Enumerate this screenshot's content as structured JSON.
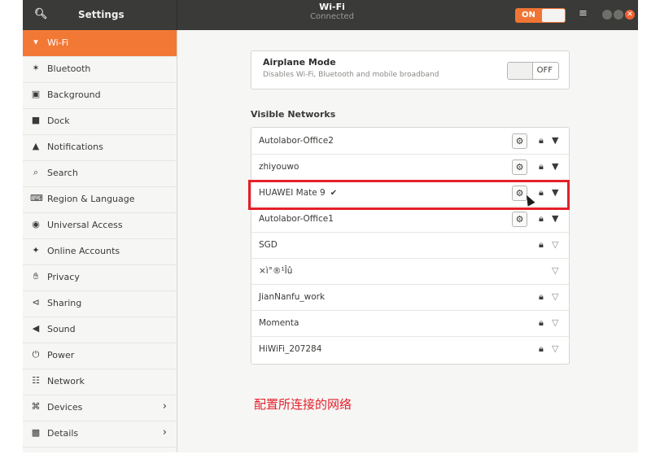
{
  "header": {
    "settings_title": "Settings",
    "window_title": "Wi-Fi",
    "window_subtitle": "Connected",
    "wifi_toggle_label": "ON",
    "menu_icon": "hamburger-menu-icon"
  },
  "sidebar": {
    "items": [
      {
        "label": "Wi-Fi",
        "icon": "wifi-icon",
        "active": true
      },
      {
        "label": "Bluetooth",
        "icon": "bluetooth-icon"
      },
      {
        "label": "Background",
        "icon": "background-icon"
      },
      {
        "label": "Dock",
        "icon": "dock-icon"
      },
      {
        "label": "Notifications",
        "icon": "bell-icon"
      },
      {
        "label": "Search",
        "icon": "search-icon"
      },
      {
        "label": "Region & Language",
        "icon": "keyboard-icon"
      },
      {
        "label": "Universal Access",
        "icon": "accessibility-icon"
      },
      {
        "label": "Online Accounts",
        "icon": "accounts-icon"
      },
      {
        "label": "Privacy",
        "icon": "hand-icon"
      },
      {
        "label": "Sharing",
        "icon": "share-icon"
      },
      {
        "label": "Sound",
        "icon": "speaker-icon"
      },
      {
        "label": "Power",
        "icon": "power-icon"
      },
      {
        "label": "Network",
        "icon": "network-icon"
      },
      {
        "label": "Devices",
        "icon": "devices-icon",
        "chevron": true
      },
      {
        "label": "Details",
        "icon": "details-icon",
        "chevron": true
      }
    ]
  },
  "airplane": {
    "title": "Airplane Mode",
    "subtitle": "Disables Wi-Fi, Bluetooth and mobile broadband",
    "toggle_label": "OFF"
  },
  "networks_title": "Visible Networks",
  "networks": [
    {
      "name": "Autolabor-Office2",
      "connected": false,
      "gear": true,
      "lock": true,
      "signal": "strong"
    },
    {
      "name": "zhiyouwo",
      "connected": false,
      "gear": true,
      "lock": true,
      "signal": "strong"
    },
    {
      "name": "HUAWEI Mate 9",
      "connected": true,
      "gear": true,
      "lock": true,
      "signal": "strong"
    },
    {
      "name": "Autolabor-Office1",
      "connected": false,
      "gear": true,
      "lock": true,
      "signal": "strong"
    },
    {
      "name": "SGD",
      "connected": false,
      "gear": false,
      "lock": true,
      "signal": "medium"
    },
    {
      "name": "×ì°®¹Îû",
      "connected": false,
      "gear": false,
      "lock": false,
      "signal": "weak"
    },
    {
      "name": "JianNanfu_work",
      "connected": false,
      "gear": false,
      "lock": true,
      "signal": "medium"
    },
    {
      "name": "Momenta",
      "connected": false,
      "gear": false,
      "lock": true,
      "signal": "medium"
    },
    {
      "name": "HiWiFi_207284",
      "connected": false,
      "gear": false,
      "lock": true,
      "signal": "medium"
    }
  ],
  "annotation": "配置所连接的网络",
  "colors": {
    "accent": "#f27835",
    "highlight": "#e5202a",
    "headerbar": "#3a3a38"
  }
}
